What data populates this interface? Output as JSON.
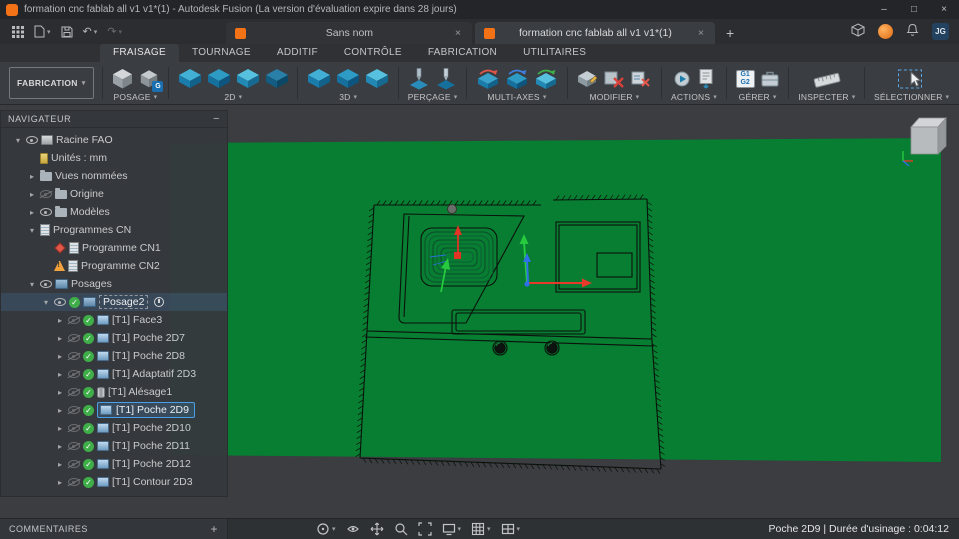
{
  "colors": {
    "stock_green": "#077e31",
    "accent_blue": "#4aa0e8",
    "brand_orange": "#f47216",
    "success_green": "#3fae49",
    "warning_orange": "#f2a33c",
    "error_red": "#e2574a"
  },
  "icons": {
    "chevron_open": "▾",
    "chevron_closed": "▸",
    "check": "✓",
    "close": "×",
    "minimize": "–",
    "maximize": "□",
    "plus_tab": "+",
    "plus": "+",
    "collapse": "−",
    "dropdown": "▾",
    "undo": "↶",
    "redo": "↷",
    "warning_mark": "!",
    "g1": "G1",
    "g2": "G2",
    "posage_badge": "G"
  },
  "titlebar": {
    "title": "formation cnc fablab all v1 v1*(1) - Autodesk Fusion (La version d'évaluation expire dans 28 jours)"
  },
  "tabbar": {
    "documents": [
      {
        "label": "Sans nom"
      },
      {
        "label": "formation cnc fablab all v1 v1*(1)"
      }
    ],
    "user_initials": "JG"
  },
  "ribbon": {
    "workspace": "FABRICATION",
    "tabs": [
      "FRAISAGE",
      "TOURNAGE",
      "ADDITIF",
      "CONTRÔLE",
      "FABRICATION",
      "UTILITAIRES"
    ],
    "groups": [
      "POSAGE",
      "2D",
      "3D",
      "PERÇAGE",
      "MULTI-AXES",
      "MODIFIER",
      "ACTIONS",
      "GÉRER",
      "INSPECTER",
      "SÉLECTIONNER"
    ]
  },
  "navigator": {
    "title": "NAVIGATEUR",
    "items": [
      {
        "label": "Racine FAO"
      },
      {
        "label": "Unités : mm"
      },
      {
        "label": "Vues nommées"
      },
      {
        "label": "Origine"
      },
      {
        "label": "Modèles"
      },
      {
        "label": "Programmes CN"
      },
      {
        "label": "Programme CN1"
      },
      {
        "label": "Programme CN2"
      },
      {
        "label": "Posages"
      },
      {
        "label": "Posage2"
      },
      {
        "label": "[T1] Face3"
      },
      {
        "label": "[T1] Poche 2D7"
      },
      {
        "label": "[T1] Poche 2D8"
      },
      {
        "label": "[T1] Adaptatif 2D3"
      },
      {
        "label": "[T1] Alésage1"
      },
      {
        "label": "[T1] Poche 2D9"
      },
      {
        "label": "[T1] Poche 2D10"
      },
      {
        "label": "[T1] Poche 2D11"
      },
      {
        "label": "[T1] Poche 2D12"
      },
      {
        "label": "[T1] Contour 2D3"
      }
    ]
  },
  "bottombar": {
    "comments_label": "COMMENTAIRES",
    "status": "Poche 2D9 | Durée d'usinage : 0:04:12"
  }
}
